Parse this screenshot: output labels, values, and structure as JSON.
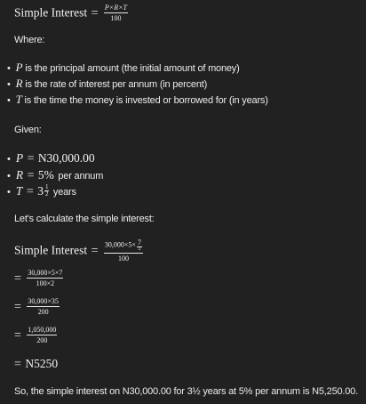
{
  "formula": {
    "lhs": "Simple Interest",
    "eq": "=",
    "num": "P×R×T",
    "den": "100"
  },
  "where_label": "Where:",
  "definitions": [
    {
      "sym": "P",
      "text": "is the principal amount (the initial amount of money)"
    },
    {
      "sym": "R",
      "text": "is the rate of interest per annum (in percent)"
    },
    {
      "sym": "T",
      "text": "is the time the money is invested or borrowed for (in years)"
    }
  ],
  "given_label": "Given:",
  "given": {
    "p": {
      "sym": "P",
      "eq": "=",
      "val": "N30,000.00"
    },
    "r": {
      "sym": "R",
      "eq": "=",
      "val": "5%",
      "suffix": "per annum"
    },
    "t": {
      "sym": "T",
      "eq": "=",
      "whole": "3",
      "fnum": "1",
      "fden": "2",
      "suffix": "years"
    }
  },
  "calc_label": "Let's calculate the simple interest:",
  "step1": {
    "lhs": "Simple Interest",
    "eq": "=",
    "num": "30,000×5×",
    "fnum": "7",
    "fden": "2",
    "den": "100"
  },
  "step2": {
    "eq": "=",
    "num": "30,000×5×7",
    "den": "100×2"
  },
  "step3": {
    "eq": "=",
    "num": "30,000×35",
    "den": "200"
  },
  "step4": {
    "eq": "=",
    "num": "1,050,000",
    "den": "200"
  },
  "step5": {
    "eq": "=",
    "val": "N5250"
  },
  "conclusion": "So, the simple interest on N30,000.00 for 3½ years at 5% per annum is N5,250.00."
}
